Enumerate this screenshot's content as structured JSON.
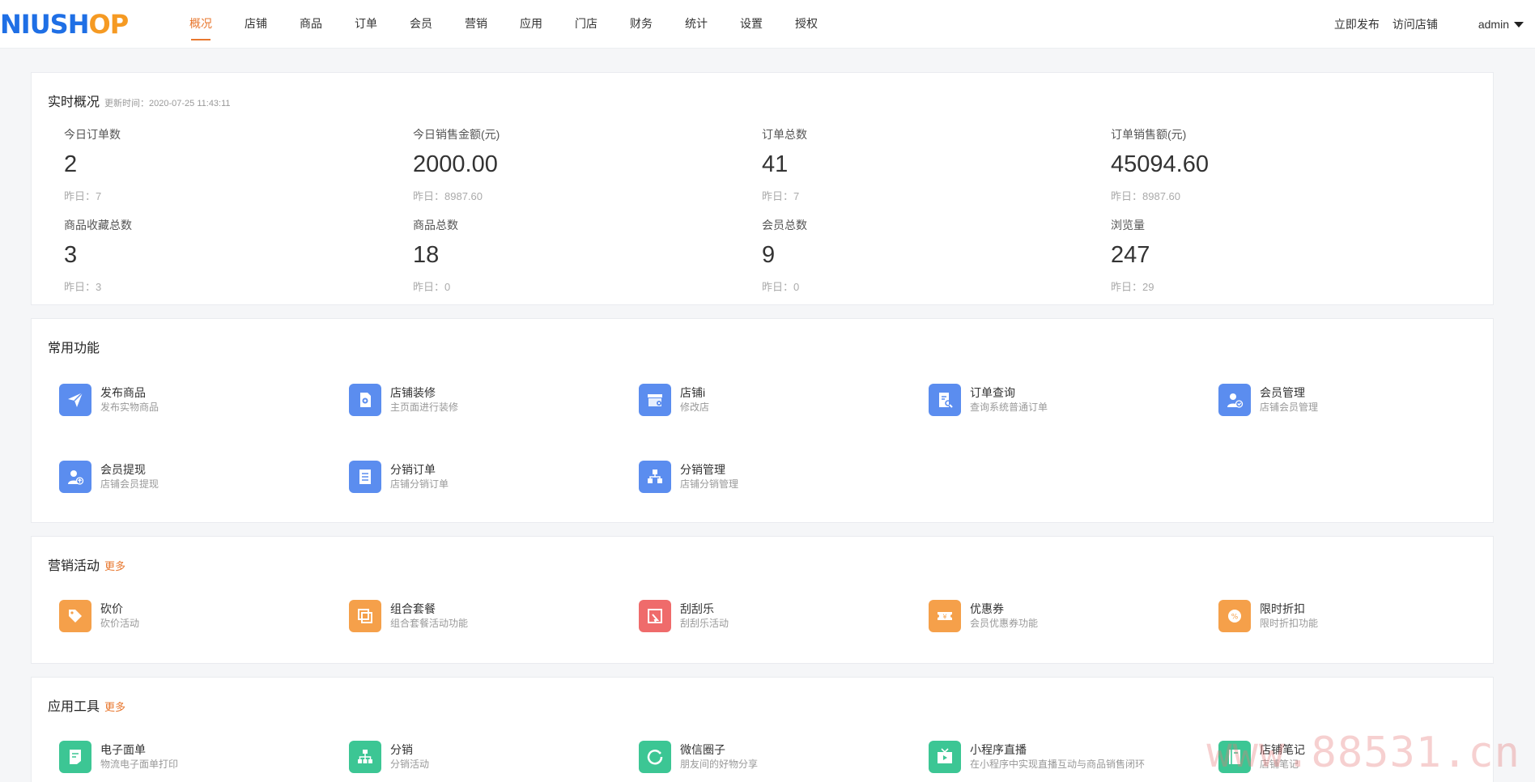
{
  "logo": {
    "part1": "NIUSH",
    "part2": "OP"
  },
  "nav": [
    "概况",
    "店铺",
    "商品",
    "订单",
    "会员",
    "营销",
    "应用",
    "门店",
    "财务",
    "统计",
    "设置",
    "授权"
  ],
  "topright": {
    "publish": "立即发布",
    "visit": "访问店铺",
    "user": "admin"
  },
  "realtime": {
    "title": "实时概况",
    "update_label": "更新时间：",
    "update_time": "2020-07-25 11:43:11",
    "stats": [
      {
        "label": "今日订单数",
        "value": "2",
        "yesterday": "昨日：7"
      },
      {
        "label": "今日销售金额(元)",
        "value": "2000.00",
        "yesterday": "昨日：8987.60"
      },
      {
        "label": "订单总数",
        "value": "41",
        "yesterday": "昨日：7"
      },
      {
        "label": "订单销售额(元)",
        "value": "45094.60",
        "yesterday": "昨日：8987.60"
      },
      {
        "label": "商品收藏总数",
        "value": "3",
        "yesterday": "昨日：3"
      },
      {
        "label": "商品总数",
        "value": "18",
        "yesterday": "昨日：0"
      },
      {
        "label": "会员总数",
        "value": "9",
        "yesterday": "昨日：0"
      },
      {
        "label": "浏览量",
        "value": "247",
        "yesterday": "昨日：29"
      }
    ]
  },
  "common": {
    "title": "常用功能",
    "items": [
      {
        "title": "发布商品",
        "desc": "发布实物商品",
        "icon": "paper-plane-icon",
        "color": "#5b8def"
      },
      {
        "title": "店铺装修",
        "desc": "主页面进行装修",
        "icon": "design-icon",
        "color": "#5b8def"
      },
      {
        "title": "店铺i",
        "desc": "修改店",
        "icon": "shop-settings-icon",
        "color": "#5b8def"
      },
      {
        "title": "订单查询",
        "desc": "查询系统普通订单",
        "icon": "order-search-icon",
        "color": "#5b8def"
      },
      {
        "title": "会员管理",
        "desc": "店铺会员管理",
        "icon": "member-icon",
        "color": "#5b8def"
      },
      {
        "title": "会员提现",
        "desc": "店铺会员提现",
        "icon": "member-withdraw-icon",
        "color": "#5b8def"
      },
      {
        "title": "分销订单",
        "desc": "店铺分销订单",
        "icon": "list-icon",
        "color": "#5b8def"
      },
      {
        "title": "分销管理",
        "desc": "店铺分销管理",
        "icon": "distribution-icon",
        "color": "#5b8def"
      }
    ]
  },
  "marketing": {
    "title": "营销活动",
    "more": "更多",
    "items": [
      {
        "title": "砍价",
        "desc": "砍价活动",
        "icon": "bargain-icon",
        "color": "#f5a04a"
      },
      {
        "title": "组合套餐",
        "desc": "组合套餐活动功能",
        "icon": "combo-icon",
        "color": "#f5a04a"
      },
      {
        "title": "刮刮乐",
        "desc": "刮刮乐活动",
        "icon": "scratch-icon",
        "color": "#ef6b6b"
      },
      {
        "title": "优惠券",
        "desc": "会员优惠券功能",
        "icon": "coupon-icon",
        "color": "#f5a04a"
      },
      {
        "title": "限时折扣",
        "desc": "限时折扣功能",
        "icon": "discount-icon",
        "color": "#f5a04a"
      }
    ]
  },
  "tools": {
    "title": "应用工具",
    "more": "更多",
    "items": [
      {
        "title": "电子面单",
        "desc": "物流电子面单打印",
        "icon": "waybill-icon",
        "color": "#3cc694"
      },
      {
        "title": "分销",
        "desc": "分销活动",
        "icon": "org-tree-icon",
        "color": "#3cc694"
      },
      {
        "title": "微信圈子",
        "desc": "朋友间的好物分享",
        "icon": "circle-icon",
        "color": "#3cc694"
      },
      {
        "title": "小程序直播",
        "desc": "在小程序中实现直播互动与商品销售闭环",
        "icon": "live-tv-icon",
        "color": "#3cc694"
      },
      {
        "title": "店铺笔记",
        "desc": "店铺笔记",
        "icon": "notebook-icon",
        "color": "#3cc694"
      }
    ]
  },
  "watermark": "www.88531.cn"
}
